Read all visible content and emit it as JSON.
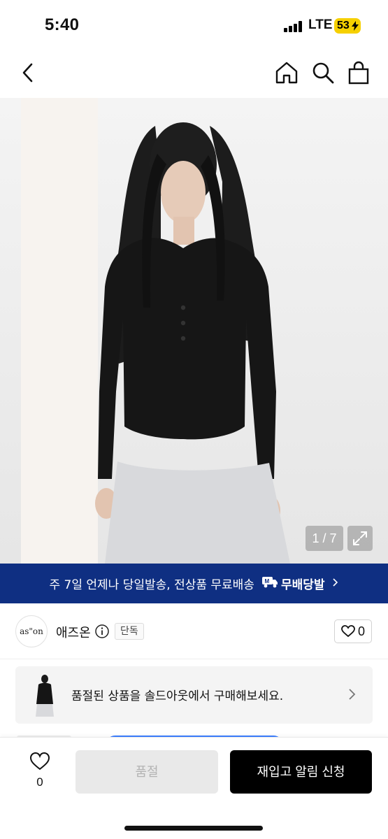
{
  "status_bar": {
    "time": "5:40",
    "network": "LTE",
    "battery": "53"
  },
  "nav": {
    "back_icon": "chevron-left-icon",
    "home_icon": "home-icon",
    "search_icon": "search-icon",
    "cart_icon": "shopping-bag-icon"
  },
  "gallery": {
    "counter": "1 / 7",
    "expand_icon": "expand-icon"
  },
  "banner": {
    "text": "주 7일 언제나 당일발송, 전상품 무료배송",
    "brand": "무배당발",
    "background": "#0f2f82"
  },
  "brand": {
    "logo_text": "as\"on",
    "name": "애즈온",
    "badge": "단독",
    "like_count": "0"
  },
  "soldout_card": {
    "text": "품절된 상품을 솔드아웃에서 구매해보세요."
  },
  "bottom_bar": {
    "wish_count": "0",
    "soldout_label": "품절",
    "restock_label": "재입고 알림 신청"
  }
}
